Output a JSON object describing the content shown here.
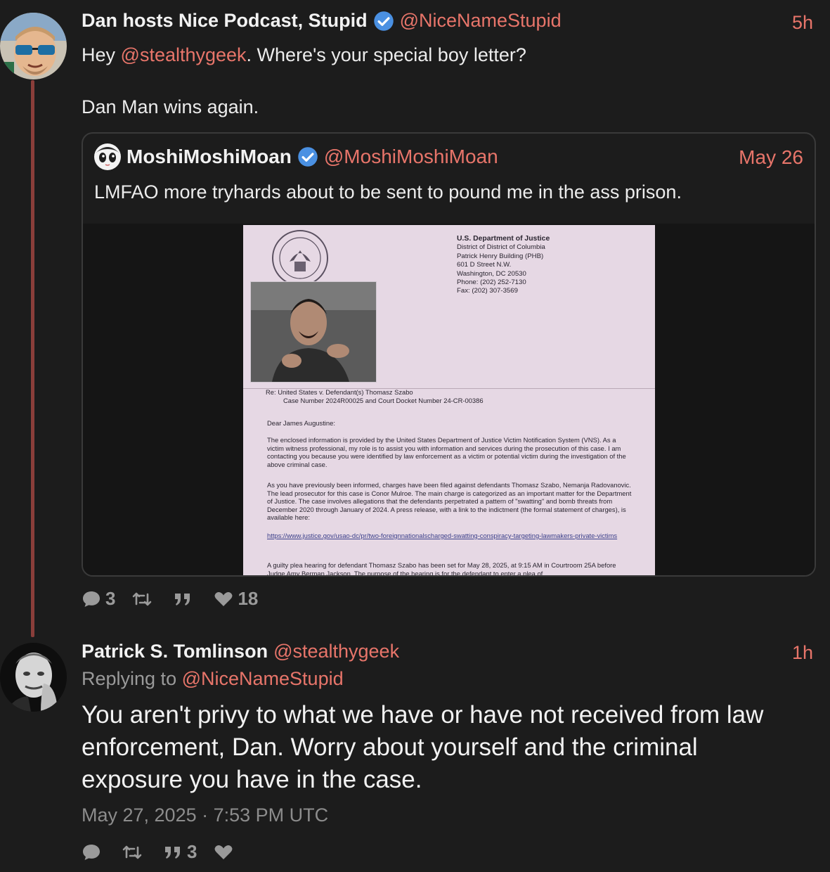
{
  "tweet1": {
    "display_name": "Dan hosts Nice Podcast, Stupid",
    "handle": "@NiceNameStupid",
    "time": "5h",
    "text_before_mention": "Hey ",
    "mention": "@stealthygeek",
    "text_after_mention": ". Where's your special boy letter?",
    "text_line2": "Dan Man wins again.",
    "stats": {
      "replies": "3",
      "retweets": "",
      "quotes": "",
      "likes": "18"
    }
  },
  "quoted": {
    "display_name": "MoshiMoshiMoan",
    "handle": "@MoshiMoshiMoan",
    "time": "May 26",
    "text": "LMFAO more tryhards about to be sent to pound me in the ass prison.",
    "letter": {
      "dept": "U.S. Department of Justice",
      "addr": [
        "District of District of Columbia",
        "Patrick Henry Building (PHB)",
        "601 D Street N.W.",
        "Washington, DC 20530",
        "Phone: (202) 252-7130",
        "Fax: (202) 307-3569"
      ],
      "re_line1": "Re:  United States v. Defendant(s) Thomasz Szabo",
      "re_line2": "Case Number 2024R00025 and Court Docket Number 24-CR-00386",
      "salutation": "Dear James Augustine:",
      "para1": "The enclosed information is provided by the United States Department of Justice Victim Notification System (VNS). As a victim witness professional, my role is to assist you with information and services during the prosecution of this case. I am contacting you because you were identified by law enforcement as a victim or potential victim during the investigation of the above criminal case.",
      "para2": "As you have previously been informed, charges have been filed against defendants Thomasz Szabo, Nemanja Radovanovic. The lead prosecutor for this case is Conor Mulroe. The main charge is categorized as an important matter for the Department of Justice. The case involves allegations that the defendants perpetrated a pattern of \"swatting\" and bomb threats from December 2020 through January of 2024. A press release, with a link to the indictment (the formal statement of charges), is available here:",
      "url": "https://www.justice.gov/usao-dc/pr/two-foreignnationalscharged-swatting-conspiracy-targeting-lawmakers-private-victims",
      "para3": "A guilty plea hearing for defendant Thomasz Szabo has been set for May 28, 2025, at 9:15 AM in Courtroom 25A before Judge Amy Berman Jackson. The purpose of the hearing is for the defendant to enter a plea of"
    }
  },
  "tweet2": {
    "display_name": "Patrick S. Tomlinson",
    "handle": "@stealthygeek",
    "time": "1h",
    "replying_label": "Replying to ",
    "replying_handle": "@NiceNameStupid",
    "text": "You aren't privy to what we have or have not received from law enforcement, Dan. Worry about yourself and the criminal exposure you have in the case.",
    "date": "May 27, 2025 · 7:53 PM UTC",
    "stats": {
      "replies": "",
      "retweets": "",
      "quotes": "3",
      "likes": ""
    }
  },
  "colors": {
    "accent": "#e8756a",
    "background": "#1c1c1c",
    "thread": "#8a3e3a",
    "verified": "#4a90e2"
  }
}
